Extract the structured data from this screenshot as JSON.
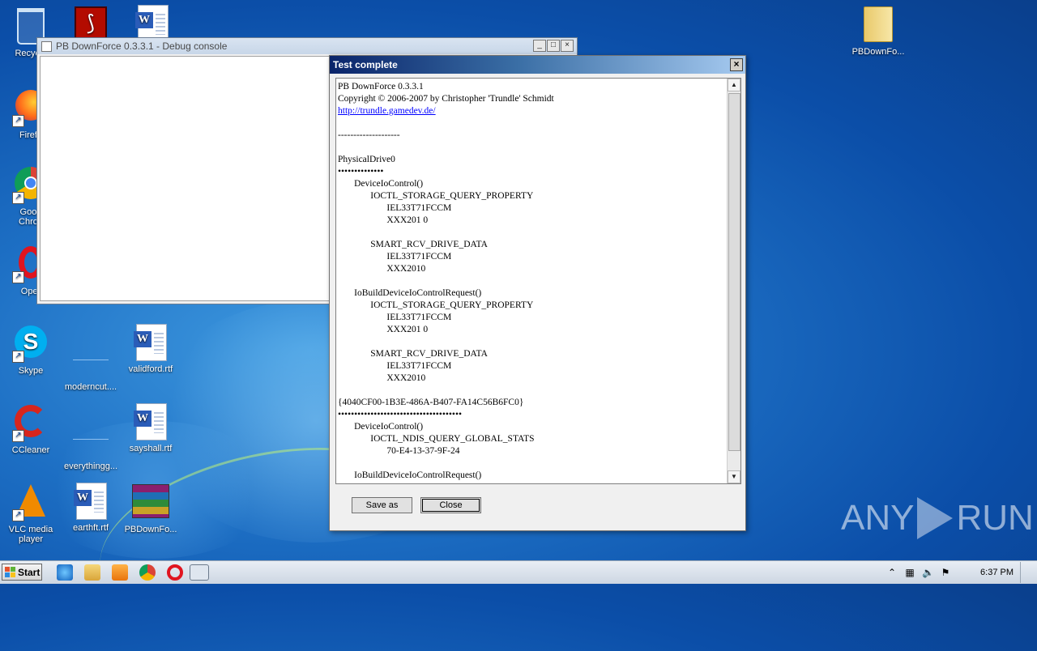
{
  "desktop": {
    "icons": [
      {
        "label": "Recycle"
      },
      {
        "label": "Firefo"
      },
      {
        "label": "Goog\nChron"
      },
      {
        "label": "Oper"
      },
      {
        "label": "Skype"
      },
      {
        "label": "moderncut...."
      },
      {
        "label": "validford.rtf"
      },
      {
        "label": "CCleaner"
      },
      {
        "label": "everythingg..."
      },
      {
        "label": "sayshall.rtf"
      },
      {
        "label": "VLC media\nplayer"
      },
      {
        "label": "earthft.rtf"
      },
      {
        "label": "PBDownFo..."
      },
      {
        "label": "PBDownFo..."
      }
    ]
  },
  "debug_window": {
    "title": "PB DownForce 0.3.3.1  -  Debug console"
  },
  "dialog": {
    "title": "Test complete",
    "close_glyph": "×",
    "text_lines": [
      "PB DownForce 0.3.3.1",
      "Copyright © 2006-2007 by Christopher 'Trundle' Schmidt",
      "http://trundle.gamedev.de/",
      "",
      "--------------------",
      "",
      "PhysicalDrive0",
      "••••••••••••••",
      "       DeviceIoControl()",
      "              IOCTL_STORAGE_QUERY_PROPERTY",
      "                     IEL33T71FCCM",
      "                     XXX201 0",
      "",
      "              SMART_RCV_DRIVE_DATA",
      "                     IEL33T71FCCM",
      "                     XXX2010",
      "",
      "       IoBuildDeviceIoControlRequest()",
      "              IOCTL_STORAGE_QUERY_PROPERTY",
      "                     IEL33T71FCCM",
      "                     XXX201 0",
      "",
      "              SMART_RCV_DRIVE_DATA",
      "                     IEL33T71FCCM",
      "                     XXX2010",
      "",
      "{4040CF00-1B3E-486A-B407-FA14C56B6FC0}",
      "••••••••••••••••••••••••••••••••••••••",
      "       DeviceIoControl()",
      "              IOCTL_NDIS_QUERY_GLOBAL_STATS",
      "                     70-E4-13-37-9F-24",
      "",
      "       IoBuildDeviceIoControlRequest()"
    ],
    "buttons": {
      "save_as": "Save as",
      "close": "Close"
    }
  },
  "watermark": {
    "left": "ANY",
    "right": "RUN"
  },
  "taskbar": {
    "start_label": "Start",
    "clock": "6:37 PM"
  },
  "colors": {
    "title_active": "#0a246a",
    "link": "#0000ff"
  }
}
